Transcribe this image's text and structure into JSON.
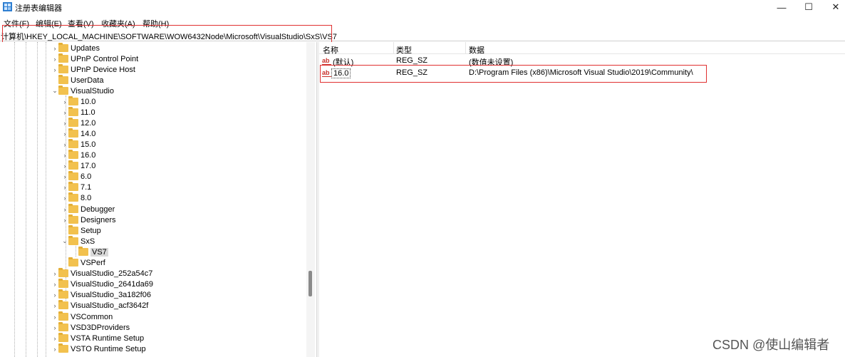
{
  "window": {
    "title": "注册表编辑器",
    "min_glyph": "—",
    "max_glyph": "☐",
    "close_glyph": "✕"
  },
  "menu": [
    "文件(F)",
    "编辑(E)",
    "查看(V)",
    "收藏夹(A)",
    "帮助(H)"
  ],
  "address": "计算机\\HKEY_LOCAL_MACHINE\\SOFTWARE\\WOW6432Node\\Microsoft\\VisualStudio\\SxS\\VS7",
  "tree": {
    "items": [
      {
        "label": "Updates",
        "chevron": ">"
      },
      {
        "label": "UPnP Control Point",
        "chevron": ">"
      },
      {
        "label": "UPnP Device Host",
        "chevron": ">"
      },
      {
        "label": "UserData",
        "chevron": ""
      },
      {
        "label": "VisualStudio",
        "chevron": "v"
      },
      {
        "label": "10.0",
        "chevron": ">"
      },
      {
        "label": "11.0",
        "chevron": ">"
      },
      {
        "label": "12.0",
        "chevron": ">"
      },
      {
        "label": "14.0",
        "chevron": ">"
      },
      {
        "label": "15.0",
        "chevron": ">"
      },
      {
        "label": "16.0",
        "chevron": ">"
      },
      {
        "label": "17.0",
        "chevron": ">"
      },
      {
        "label": "6.0",
        "chevron": ">"
      },
      {
        "label": "7.1",
        "chevron": ">"
      },
      {
        "label": "8.0",
        "chevron": ">"
      },
      {
        "label": "Debugger",
        "chevron": ">"
      },
      {
        "label": "Designers",
        "chevron": ">"
      },
      {
        "label": "Setup",
        "chevron": ""
      },
      {
        "label": "SxS",
        "chevron": "v"
      },
      {
        "label": "VS7",
        "chevron": "",
        "selected": true
      },
      {
        "label": "VSPerf",
        "chevron": ""
      },
      {
        "label": "VisualStudio_252a54c7",
        "chevron": ">"
      },
      {
        "label": "VisualStudio_2641da69",
        "chevron": ">"
      },
      {
        "label": "VisualStudio_3a182f06",
        "chevron": ">"
      },
      {
        "label": "VisualStudio_acf3642f",
        "chevron": ">"
      },
      {
        "label": "VSCommon",
        "chevron": ">"
      },
      {
        "label": "VSD3DProviders",
        "chevron": ">"
      },
      {
        "label": "VSTA Runtime Setup",
        "chevron": ">"
      },
      {
        "label": "VSTO Runtime Setup",
        "chevron": ">"
      }
    ]
  },
  "list": {
    "headers": {
      "name": "名称",
      "type": "类型",
      "data": "数据"
    },
    "rows": [
      {
        "icon": "ab",
        "name": "(默认)",
        "type": "REG_SZ",
        "data": "(数值未设置)"
      },
      {
        "icon": "ab",
        "name": "16.0",
        "type": "REG_SZ",
        "data": "D:\\Program Files (x86)\\Microsoft Visual Studio\\2019\\Community\\"
      }
    ]
  },
  "watermark": "CSDN @使山编辑者",
  "colors": {
    "folder": "#f2c14e",
    "highlight_box": "#e03030",
    "string_icon": "#c8312b",
    "selection": "#d9d9d9"
  }
}
